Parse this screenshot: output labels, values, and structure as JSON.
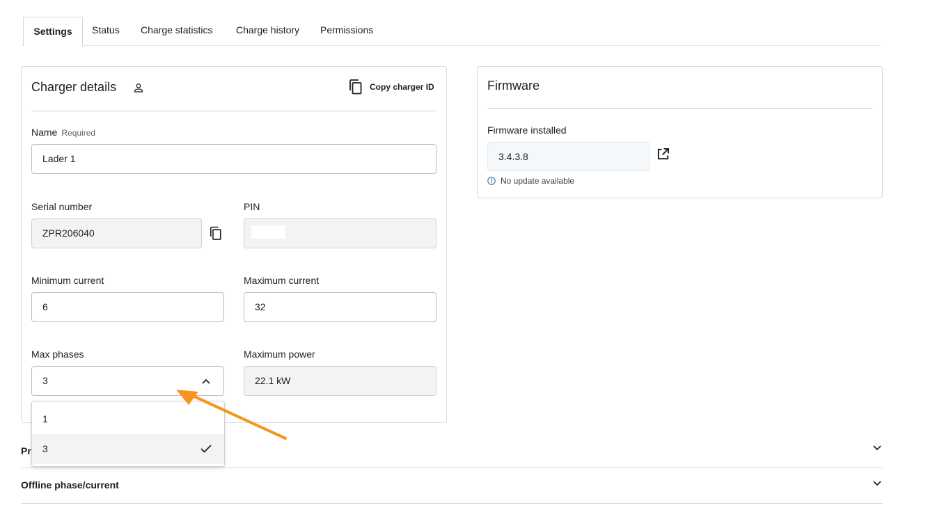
{
  "tabs": [
    {
      "label": "Settings",
      "active": true
    },
    {
      "label": "Status"
    },
    {
      "label": "Charge statistics"
    },
    {
      "label": "Charge history"
    },
    {
      "label": "Permissions"
    }
  ],
  "charger": {
    "title": "Charger details",
    "copy_id_label": "Copy charger ID",
    "name_label": "Name",
    "name_required": "Required",
    "name_value": "Lader 1",
    "serial_label": "Serial number",
    "serial_value": "ZPR206040",
    "pin_label": "PIN",
    "min_current_label": "Minimum current",
    "min_current_value": "6",
    "max_current_label": "Maximum current",
    "max_current_value": "32",
    "max_phases_label": "Max phases",
    "max_phases_value": "3",
    "max_power_label": "Maximum power",
    "max_power_value": "22.1 kW"
  },
  "dropdown": {
    "options": [
      "1",
      "3"
    ],
    "selected": "3"
  },
  "firmware": {
    "title": "Firmware",
    "installed_label": "Firmware installed",
    "installed_value": "3.4.3.8",
    "status": "No update available"
  },
  "accordions": [
    {
      "title": "Pr"
    },
    {
      "title": "Offline phase/current"
    }
  ],
  "annotation": {
    "arrow_color": "#f7941d"
  },
  "icons": [
    "person-icon",
    "copy-icon",
    "chevron-up-icon",
    "check-icon",
    "chevron-down-icon",
    "open-external-icon",
    "info-icon"
  ]
}
